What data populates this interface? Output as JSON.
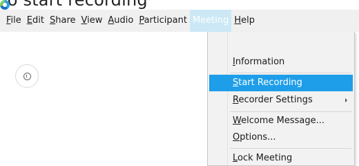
{
  "page": {
    "heading": "To start recording"
  },
  "menubar": {
    "items": [
      {
        "label": "File",
        "mnemonic": "F",
        "rest": "ile"
      },
      {
        "label": "Edit",
        "mnemonic": "E",
        "rest": "dit"
      },
      {
        "label": "Share",
        "mnemonic": "S",
        "rest": "hare"
      },
      {
        "label": "View",
        "mnemonic": "V",
        "rest": "iew"
      },
      {
        "label": "Audio",
        "mnemonic": "A",
        "rest": "udio"
      },
      {
        "label": "Participant",
        "mnemonic": "P",
        "rest": "articipant"
      },
      {
        "label": "Meeting",
        "mnemonic": "",
        "rest": "Meeting"
      },
      {
        "label": "Help",
        "mnemonic": "H",
        "rest": "elp"
      }
    ]
  },
  "meeting_menu": {
    "items": [
      {
        "label": "Information",
        "mnemonic": "I",
        "rest": "nformation"
      },
      {
        "label": "Start Recording",
        "mnemonic": "S",
        "rest": "tart Recording"
      },
      {
        "label": "Recorder Settings",
        "mnemonic": "R",
        "rest": "ecorder Settings"
      },
      {
        "label": "Welcome Message...",
        "mnemonic": "W",
        "rest": "elcome Message..."
      },
      {
        "label": "Options...",
        "mnemonic": "O",
        "rest": "ptions..."
      },
      {
        "label": "Lock Meeting",
        "mnemonic": "L",
        "rest": "ock Meeting"
      }
    ],
    "highlight_color": "#1e9ee9"
  },
  "icons": {
    "app_logo": "app-logo-icon",
    "circle_button": "info-circle-icon",
    "submenu_arrow": "chevron-right-icon"
  }
}
